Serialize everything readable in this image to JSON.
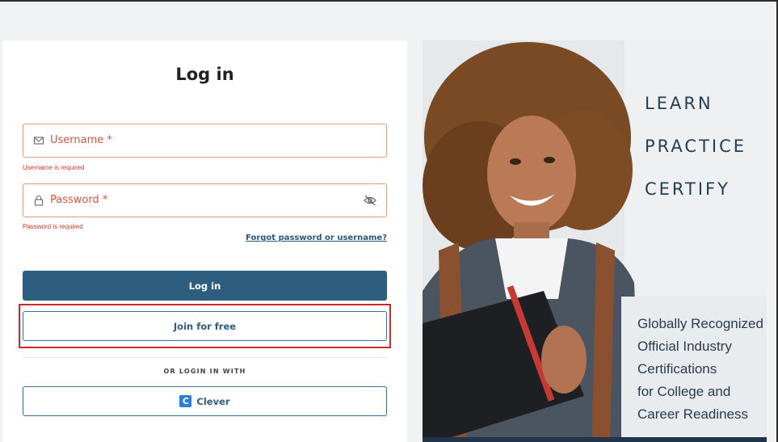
{
  "login": {
    "title": "Log in",
    "username_label": "Username *",
    "username_error": "Username is required",
    "password_label": "Password *",
    "password_error": "Password is required",
    "forgot_link": "Forgot password or username?",
    "login_button": "Log in",
    "join_button": "Join for free",
    "or_login_with": "OR LOGIN IN WITH",
    "clever_button": "Clever",
    "clever_logo_letter": "C"
  },
  "promo": {
    "words": [
      "LEARN",
      "PRACTICE",
      "CERTIFY"
    ],
    "box_lines": [
      "Globally Recognized",
      "Official Industry",
      "Certifications",
      "for College and",
      "Career Readiness"
    ]
  },
  "icons": {
    "username": "envelope-icon",
    "password": "lock-icon",
    "visibility": "eye-off-icon"
  },
  "colors": {
    "primary": "#2d5e80",
    "error": "#d8553a",
    "highlight": "#cc2a2a"
  }
}
